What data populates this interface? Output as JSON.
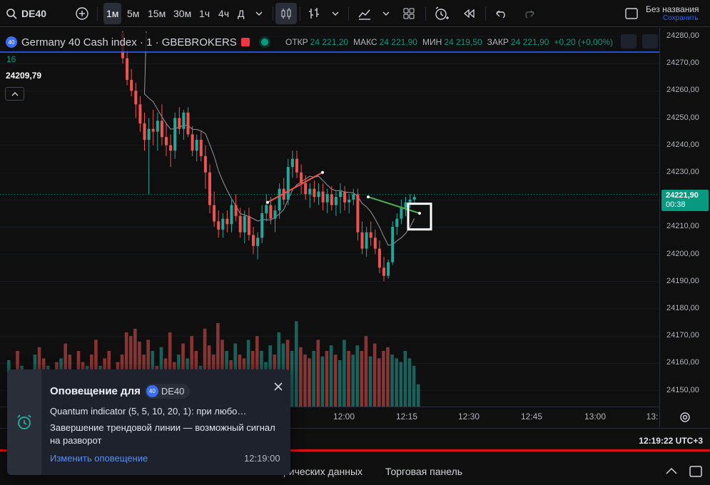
{
  "toolbar": {
    "symbol": "DE40",
    "intervals": [
      "1м",
      "5м",
      "15м",
      "30м",
      "1ч",
      "4ч",
      "Д"
    ],
    "active_interval": "1м",
    "layout_title": "Без названия",
    "layout_status": "Сохранить"
  },
  "legend": {
    "badge": "40",
    "title": "Germany 40 Cash index · 1 · GBEBROKERS",
    "ohlc": [
      {
        "k": "ОТКР",
        "v": "24 221,20"
      },
      {
        "k": "МАКС",
        "v": "24 221,90"
      },
      {
        "k": "МИН",
        "v": "24 219,50"
      },
      {
        "k": "ЗАКР",
        "v": "24 221,90"
      },
      {
        "k": "",
        "v": "+0,20 (+0,00%)"
      }
    ],
    "indicator_value": "16",
    "indicator_price": "24209,79"
  },
  "price_axis": {
    "labels": [
      "24280,00",
      "24270,00",
      "24260,00",
      "24250,00",
      "24240,00",
      "24230,00",
      "24220,00",
      "24210,00",
      "24200,00",
      "24190,00",
      "24180,00",
      "24170,00",
      "24160,00",
      "24150,00"
    ],
    "last_price": "24221,90",
    "countdown": "00:38"
  },
  "time_axis": {
    "labels": [
      "12:00",
      "12:15",
      "12:30",
      "12:45",
      "13:00",
      "13:"
    ]
  },
  "status_bar": {
    "clock": "12:19:22 UTC+3"
  },
  "bottom_panel": {
    "tabs": [
      "рических данных",
      "Торговая панель"
    ]
  },
  "alert": {
    "title": "Оповещение для",
    "badge": "40",
    "symbol": "DE40",
    "condition": "Quantum indicator (5, 5, 10, 20, 1): при любо…",
    "message": "Завершение трендовой линии — возможный сигнал на разворот",
    "edit_link": "Изменить оповещение",
    "time": "12:19:00"
  },
  "colors": {
    "up": "#26a69a",
    "down": "#ef5350",
    "accent": "#2962ff",
    "price_tag": "#089981",
    "alert_line": "#e01010"
  },
  "chart_data": {
    "type": "candlestick",
    "symbol": "DE40",
    "interval": "1m",
    "ylim": [
      24145,
      24285
    ],
    "ohlc": [
      [
        24281,
        24282,
        24270,
        24272
      ],
      [
        24272,
        24275,
        24262,
        24264
      ],
      [
        24264,
        24268,
        24258,
        24260
      ],
      [
        24260,
        24263,
        24250,
        24255
      ],
      [
        24255,
        24258,
        24245,
        24248
      ],
      [
        24248,
        24252,
        24238,
        24242
      ],
      [
        24242,
        24250,
        24222,
        24246
      ],
      [
        24246,
        24253,
        24240,
        24245
      ],
      [
        24245,
        24252,
        24238,
        24249
      ],
      [
        24249,
        24255,
        24240,
        24243
      ],
      [
        24243,
        24248,
        24236,
        24240
      ],
      [
        24240,
        24244,
        24232,
        24238
      ],
      [
        24238,
        24252,
        24235,
        24250
      ],
      [
        24250,
        24254,
        24244,
        24246
      ],
      [
        24246,
        24253,
        24242,
        24252
      ],
      [
        24252,
        24254,
        24243,
        24244
      ],
      [
        24244,
        24247,
        24236,
        24238
      ],
      [
        24238,
        24244,
        24234,
        24242
      ],
      [
        24242,
        24245,
        24234,
        24236
      ],
      [
        24236,
        24240,
        24224,
        24230
      ],
      [
        24230,
        24233,
        24215,
        24218
      ],
      [
        24218,
        24223,
        24210,
        24212
      ],
      [
        24212,
        24216,
        24206,
        24209
      ],
      [
        24209,
        24215,
        24206,
        24213
      ],
      [
        24213,
        24216,
        24208,
        24211
      ],
      [
        24211,
        24220,
        24208,
        24218
      ],
      [
        24218,
        24222,
        24212,
        24214
      ],
      [
        24214,
        24217,
        24206,
        24208
      ],
      [
        24208,
        24216,
        24204,
        24214
      ],
      [
        24214,
        24217,
        24205,
        24207
      ],
      [
        24207,
        24210,
        24200,
        24203
      ],
      [
        24203,
        24208,
        24198,
        24206
      ],
      [
        24206,
        24218,
        24204,
        24215
      ],
      [
        24215,
        24222,
        24212,
        24218
      ],
      [
        24218,
        24221,
        24211,
        24213
      ],
      [
        24213,
        24218,
        24208,
        24216
      ],
      [
        24216,
        24226,
        24213,
        24224
      ],
      [
        24224,
        24228,
        24218,
        24220
      ],
      [
        24220,
        24235,
        24218,
        24232
      ],
      [
        24232,
        24238,
        24228,
        24235
      ],
      [
        24235,
        24238,
        24228,
        24230
      ],
      [
        24230,
        24233,
        24222,
        24226
      ],
      [
        24226,
        24229,
        24220,
        24222
      ],
      [
        24222,
        24226,
        24217,
        24224
      ],
      [
        24224,
        24227,
        24219,
        24221
      ],
      [
        24221,
        24226,
        24218,
        24223
      ],
      [
        24223,
        24226,
        24216,
        24219
      ],
      [
        24219,
        24224,
        24215,
        24222
      ],
      [
        24222,
        24225,
        24216,
        24218
      ],
      [
        24218,
        24223,
        24214,
        24221
      ],
      [
        24221,
        24226,
        24215,
        24223
      ],
      [
        24223,
        24225,
        24216,
        24219
      ],
      [
        24219,
        24222,
        24215,
        24220
      ],
      [
        24220,
        24224,
        24218,
        24222
      ],
      [
        24222,
        24224,
        24205,
        24208
      ],
      [
        24208,
        24212,
        24200,
        24202
      ],
      [
        24202,
        24210,
        24199,
        24208
      ],
      [
        24208,
        24212,
        24203,
        24206
      ],
      [
        24206,
        24209,
        24200,
        24202
      ],
      [
        24202,
        24205,
        24193,
        24195
      ],
      [
        24195,
        24199,
        24190,
        24192
      ],
      [
        24192,
        24198,
        24191,
        24197
      ],
      [
        24197,
        24212,
        24196,
        24210
      ],
      [
        24210,
        24215,
        24207,
        24213
      ],
      [
        24213,
        24220,
        24211,
        24217
      ],
      [
        24217,
        24221,
        24214,
        24219
      ],
      [
        24219,
        24222,
        24217,
        24220
      ],
      [
        24220,
        24222,
        24219,
        24221
      ]
    ],
    "volume": [
      40,
      38,
      42,
      35,
      28,
      36,
      30,
      22,
      32,
      26,
      40,
      24,
      28,
      34,
      26,
      38,
      30,
      22,
      42,
      33,
      28,
      45,
      36,
      30,
      25,
      34,
      28,
      26,
      36,
      30,
      38,
      30,
      24,
      33,
      28,
      40,
      34,
      36,
      30,
      46,
      32,
      28,
      26,
      30,
      36,
      27,
      30,
      33,
      28,
      25,
      36,
      30,
      28,
      33,
      30,
      38,
      27,
      34,
      26,
      30,
      32,
      28,
      26,
      24,
      30,
      26,
      22,
      12
    ]
  }
}
